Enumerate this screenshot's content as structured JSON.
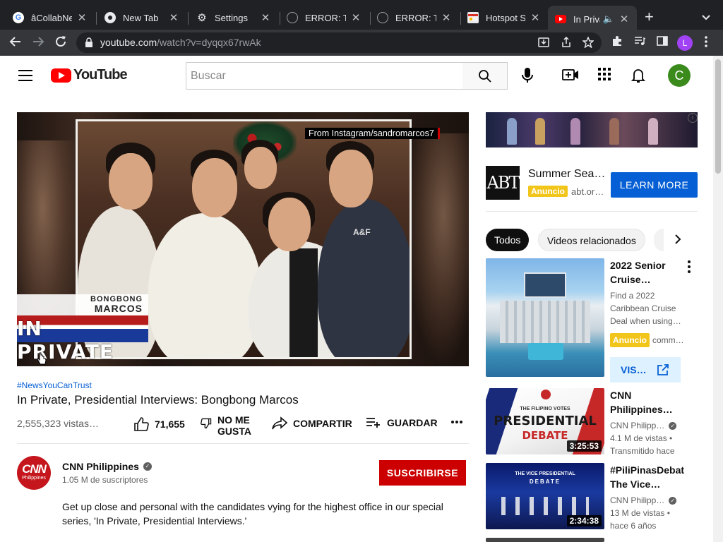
{
  "browser": {
    "tabs": [
      {
        "title": "âCollabNet",
        "favicon": "google-g"
      },
      {
        "title": "New Tab",
        "favicon": "chrome"
      },
      {
        "title": "Settings",
        "favicon": "gear"
      },
      {
        "title": "ERROR: Th",
        "favicon": "globe"
      },
      {
        "title": "ERROR: Th",
        "favicon": "globe"
      },
      {
        "title": "Hotspot Sh",
        "favicon": "hotspot"
      },
      {
        "title": "In Priva",
        "favicon": "youtube",
        "active": true
      }
    ],
    "url_host": "youtube.com",
    "url_path": "/watch?v=dyqqx67rwAk",
    "profile_initial": "L"
  },
  "youtube": {
    "logo_text": "YouTube",
    "search_placeholder": "Buscar",
    "user_initial": "C"
  },
  "video": {
    "overlay_caption": "From Instagram/sandromarcos7",
    "lower_third_top_line1": "BONGBONG",
    "lower_third_top_line2": "MARCOS",
    "lower_third_bottom": "IN PRIVATE",
    "hashtag": "#NewsYouCanTrust",
    "title": "In Private, Presidential Interviews: Bongbong Marcos",
    "views": "2,555,323 vistas…",
    "likes": "71,655",
    "dislike_label": "NO ME GUSTA",
    "share_label": "COMPARTIR",
    "save_label": "GUARDAR"
  },
  "channel": {
    "avatar_big": "CNN",
    "avatar_small": "Philippines",
    "name": "CNN Philippines",
    "subscribers": "1.05 M de suscriptores",
    "subscribe_label": "SUSCRIBIRSE",
    "description": "Get up close and personal with the candidates vying for the highest office in our special series, 'In Private, Presidential Interviews.'"
  },
  "sidebar": {
    "ad": {
      "logo_text": "ABT",
      "title": "Summer Sea…",
      "badge": "Anuncio",
      "domain": "abt.or…",
      "cta": "LEARN MORE"
    },
    "chips": [
      "Todos",
      "Videos relacionados"
    ],
    "cards": [
      {
        "title": "2022 Senior Cruise…",
        "desc": "Find a 2022 Caribbean Cruise Deal when using…",
        "badge": "Anuncio",
        "domain": "comm…",
        "cta": "VIS…"
      },
      {
        "title": "CNN Philippines…",
        "channel": "CNN Philipp…",
        "views": "4.1 M de vistas •",
        "when": "Transmitido hace",
        "duration": "3:25:53",
        "thumb_line1": "THE FILIPINO VOTES",
        "thumb_line2": "PRESIDENTIAL",
        "thumb_line3": "DEBATE"
      },
      {
        "title": "#PiliPinasDebat The Vice…",
        "channel": "CNN Philipp…",
        "views": "13 M de vistas •",
        "when": "hace 6 años",
        "duration": "2:34:38",
        "thumb_line1": "THE VICE PRESIDENTIAL",
        "thumb_line2": "DEBATE"
      }
    ]
  },
  "colors": {
    "yt_red": "#ff0000",
    "subscribe_red": "#cc0000",
    "link_blue": "#065fd4",
    "ad_badge": "#f2c51b"
  }
}
